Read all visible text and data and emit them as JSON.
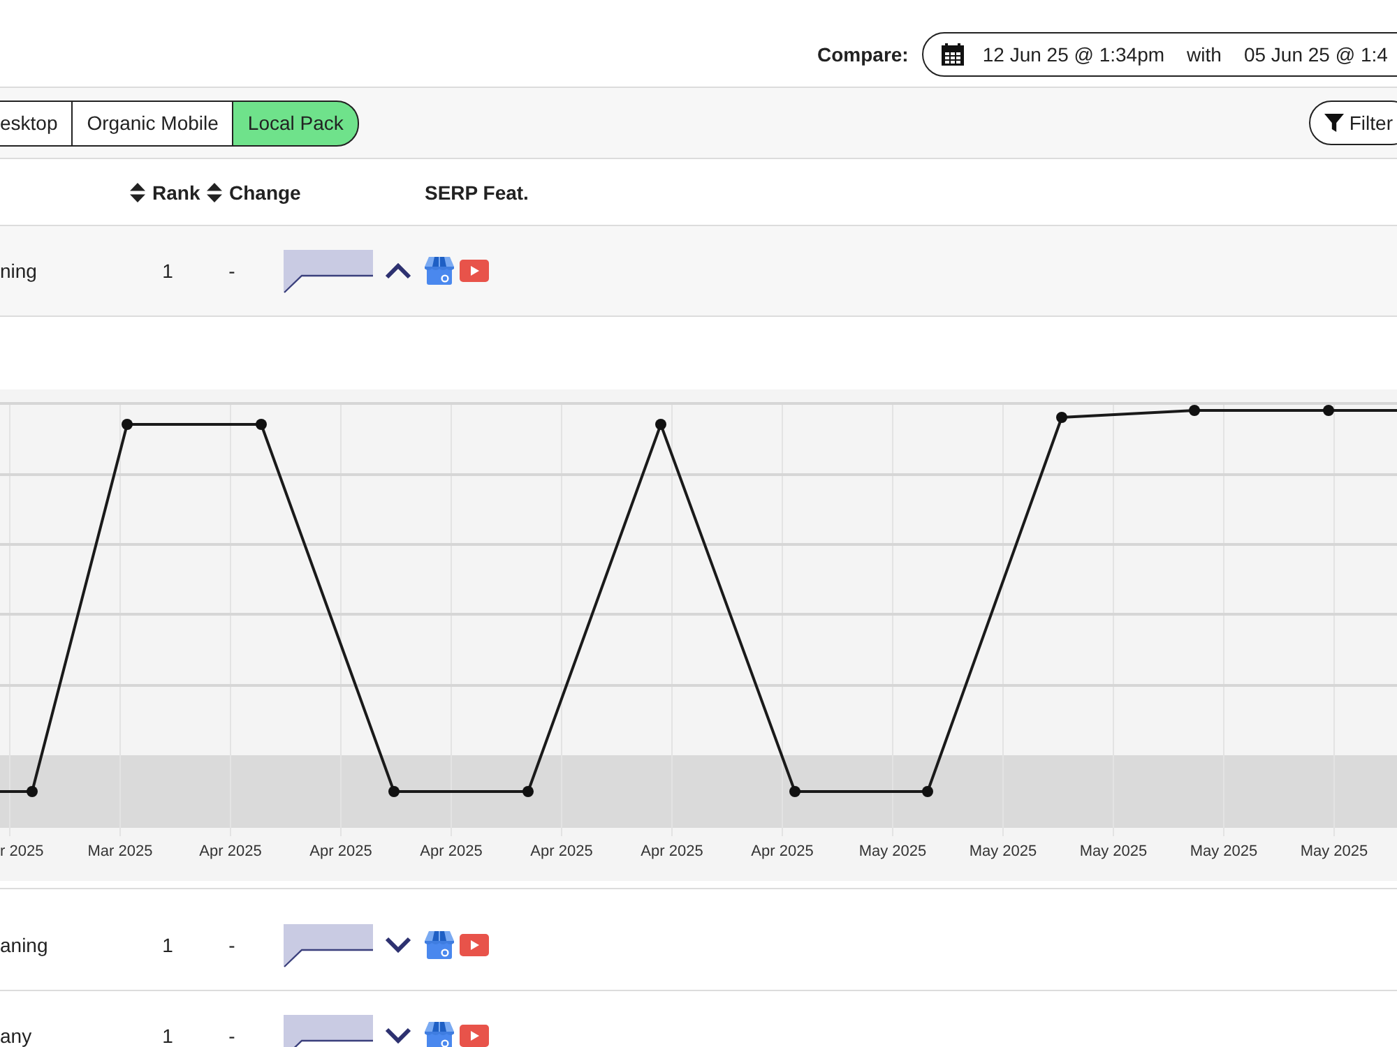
{
  "compare": {
    "label": "Compare:",
    "from": "12 Jun 25 @ 1:34pm",
    "joiner": "with",
    "to": "05 Jun 25 @ 1:4"
  },
  "tabs": [
    {
      "label": "esktop",
      "selected": false
    },
    {
      "label": "Organic Mobile",
      "selected": false
    },
    {
      "label": "Local Pack",
      "selected": true
    }
  ],
  "filter_button": {
    "label": "Filter"
  },
  "table": {
    "columns": [
      {
        "label": "Rank",
        "sortable": true
      },
      {
        "label": "Change",
        "sortable": true
      },
      {
        "label": "SERP Feat.",
        "sortable": false
      }
    ],
    "rows": [
      {
        "keyword": "ning",
        "rank": "1",
        "change": "-",
        "expanded": true,
        "detail_chart": {
          "x_tick_labels": [
            "r 2025",
            "Mar 2025",
            "Apr 2025",
            "Apr 2025",
            "Apr 2025",
            "Apr 2025",
            "Apr 2025",
            "Apr 2025",
            "May 2025",
            "May 2025",
            "May 2025",
            "May 2025",
            "May 2025"
          ]
        }
      },
      {
        "keyword": "aning",
        "rank": "1",
        "change": "-",
        "expanded": false
      },
      {
        "keyword": "any",
        "rank": "1",
        "change": "-",
        "expanded": false
      }
    ]
  }
}
